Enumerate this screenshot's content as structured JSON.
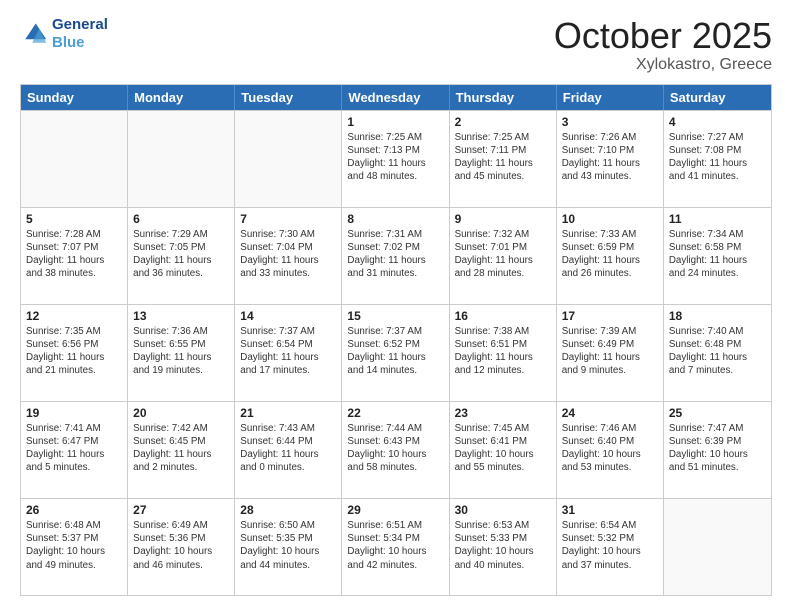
{
  "header": {
    "logo_line1": "General",
    "logo_line2": "Blue",
    "month": "October 2025",
    "location": "Xylokastro, Greece"
  },
  "days_of_week": [
    "Sunday",
    "Monday",
    "Tuesday",
    "Wednesday",
    "Thursday",
    "Friday",
    "Saturday"
  ],
  "weeks": [
    [
      {
        "day": "",
        "info": ""
      },
      {
        "day": "",
        "info": ""
      },
      {
        "day": "",
        "info": ""
      },
      {
        "day": "1",
        "info": "Sunrise: 7:25 AM\nSunset: 7:13 PM\nDaylight: 11 hours\nand 48 minutes."
      },
      {
        "day": "2",
        "info": "Sunrise: 7:25 AM\nSunset: 7:11 PM\nDaylight: 11 hours\nand 45 minutes."
      },
      {
        "day": "3",
        "info": "Sunrise: 7:26 AM\nSunset: 7:10 PM\nDaylight: 11 hours\nand 43 minutes."
      },
      {
        "day": "4",
        "info": "Sunrise: 7:27 AM\nSunset: 7:08 PM\nDaylight: 11 hours\nand 41 minutes."
      }
    ],
    [
      {
        "day": "5",
        "info": "Sunrise: 7:28 AM\nSunset: 7:07 PM\nDaylight: 11 hours\nand 38 minutes."
      },
      {
        "day": "6",
        "info": "Sunrise: 7:29 AM\nSunset: 7:05 PM\nDaylight: 11 hours\nand 36 minutes."
      },
      {
        "day": "7",
        "info": "Sunrise: 7:30 AM\nSunset: 7:04 PM\nDaylight: 11 hours\nand 33 minutes."
      },
      {
        "day": "8",
        "info": "Sunrise: 7:31 AM\nSunset: 7:02 PM\nDaylight: 11 hours\nand 31 minutes."
      },
      {
        "day": "9",
        "info": "Sunrise: 7:32 AM\nSunset: 7:01 PM\nDaylight: 11 hours\nand 28 minutes."
      },
      {
        "day": "10",
        "info": "Sunrise: 7:33 AM\nSunset: 6:59 PM\nDaylight: 11 hours\nand 26 minutes."
      },
      {
        "day": "11",
        "info": "Sunrise: 7:34 AM\nSunset: 6:58 PM\nDaylight: 11 hours\nand 24 minutes."
      }
    ],
    [
      {
        "day": "12",
        "info": "Sunrise: 7:35 AM\nSunset: 6:56 PM\nDaylight: 11 hours\nand 21 minutes."
      },
      {
        "day": "13",
        "info": "Sunrise: 7:36 AM\nSunset: 6:55 PM\nDaylight: 11 hours\nand 19 minutes."
      },
      {
        "day": "14",
        "info": "Sunrise: 7:37 AM\nSunset: 6:54 PM\nDaylight: 11 hours\nand 17 minutes."
      },
      {
        "day": "15",
        "info": "Sunrise: 7:37 AM\nSunset: 6:52 PM\nDaylight: 11 hours\nand 14 minutes."
      },
      {
        "day": "16",
        "info": "Sunrise: 7:38 AM\nSunset: 6:51 PM\nDaylight: 11 hours\nand 12 minutes."
      },
      {
        "day": "17",
        "info": "Sunrise: 7:39 AM\nSunset: 6:49 PM\nDaylight: 11 hours\nand 9 minutes."
      },
      {
        "day": "18",
        "info": "Sunrise: 7:40 AM\nSunset: 6:48 PM\nDaylight: 11 hours\nand 7 minutes."
      }
    ],
    [
      {
        "day": "19",
        "info": "Sunrise: 7:41 AM\nSunset: 6:47 PM\nDaylight: 11 hours\nand 5 minutes."
      },
      {
        "day": "20",
        "info": "Sunrise: 7:42 AM\nSunset: 6:45 PM\nDaylight: 11 hours\nand 2 minutes."
      },
      {
        "day": "21",
        "info": "Sunrise: 7:43 AM\nSunset: 6:44 PM\nDaylight: 11 hours\nand 0 minutes."
      },
      {
        "day": "22",
        "info": "Sunrise: 7:44 AM\nSunset: 6:43 PM\nDaylight: 10 hours\nand 58 minutes."
      },
      {
        "day": "23",
        "info": "Sunrise: 7:45 AM\nSunset: 6:41 PM\nDaylight: 10 hours\nand 55 minutes."
      },
      {
        "day": "24",
        "info": "Sunrise: 7:46 AM\nSunset: 6:40 PM\nDaylight: 10 hours\nand 53 minutes."
      },
      {
        "day": "25",
        "info": "Sunrise: 7:47 AM\nSunset: 6:39 PM\nDaylight: 10 hours\nand 51 minutes."
      }
    ],
    [
      {
        "day": "26",
        "info": "Sunrise: 6:48 AM\nSunset: 5:37 PM\nDaylight: 10 hours\nand 49 minutes."
      },
      {
        "day": "27",
        "info": "Sunrise: 6:49 AM\nSunset: 5:36 PM\nDaylight: 10 hours\nand 46 minutes."
      },
      {
        "day": "28",
        "info": "Sunrise: 6:50 AM\nSunset: 5:35 PM\nDaylight: 10 hours\nand 44 minutes."
      },
      {
        "day": "29",
        "info": "Sunrise: 6:51 AM\nSunset: 5:34 PM\nDaylight: 10 hours\nand 42 minutes."
      },
      {
        "day": "30",
        "info": "Sunrise: 6:53 AM\nSunset: 5:33 PM\nDaylight: 10 hours\nand 40 minutes."
      },
      {
        "day": "31",
        "info": "Sunrise: 6:54 AM\nSunset: 5:32 PM\nDaylight: 10 hours\nand 37 minutes."
      },
      {
        "day": "",
        "info": ""
      }
    ]
  ]
}
